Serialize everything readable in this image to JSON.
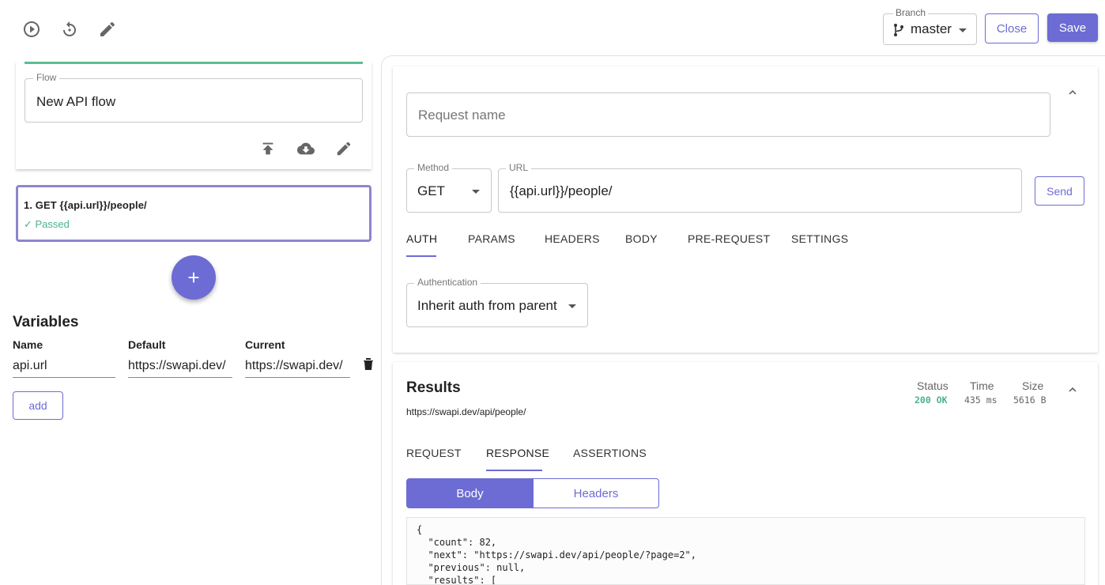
{
  "toolbar": {
    "icons": [
      "play-circle-icon",
      "reset-icon",
      "pencil-icon"
    ],
    "branch_label": "Branch",
    "branch_value": "master",
    "close_label": "Close",
    "save_label": "Save"
  },
  "flow": {
    "label": "Flow",
    "name": "New API flow"
  },
  "request_card": {
    "title": "1. GET {{api.url}}/people/",
    "status": "✓ Passed",
    "status_color": "#4bb389"
  },
  "variables": {
    "title": "Variables",
    "headers": [
      "Name",
      "Default",
      "Current"
    ],
    "rows": [
      {
        "name": "api.url",
        "default": "https://swapi.dev/",
        "current": "https://swapi.dev/"
      }
    ],
    "add_label": "add"
  },
  "request": {
    "name_placeholder": "Request name",
    "method_label": "Method",
    "method_value": "GET",
    "url_label": "URL",
    "url_value": "{{api.url}}/people/",
    "send_label": "Send",
    "tabs": [
      "AUTH",
      "PARAMS",
      "HEADERS",
      "BODY",
      "PRE-REQUEST",
      "SETTINGS"
    ],
    "active_tab": "AUTH",
    "auth_label": "Authentication",
    "auth_value": "Inherit auth from parent"
  },
  "results": {
    "title": "Results",
    "url": "https://swapi.dev/api/people/",
    "status_label": "Status",
    "status_value": "200 OK",
    "time_label": "Time",
    "time_value": "435 ms",
    "size_label": "Size",
    "size_value": "5616 B",
    "tabs": [
      "REQUEST",
      "RESPONSE",
      "ASSERTIONS"
    ],
    "active_tab": "RESPONSE",
    "segments": [
      "Body",
      "Headers"
    ],
    "active_segment": "Body",
    "body_lines": [
      "{",
      "  \"count\": 82,",
      "  \"next\": \"https://swapi.dev/api/people/?page=2\",",
      "  \"previous\": null,",
      "  \"results\": ["
    ]
  },
  "colors": {
    "accent": "#6c6cd4",
    "success": "#4bb389",
    "flow_bar": "#5bbf94"
  }
}
